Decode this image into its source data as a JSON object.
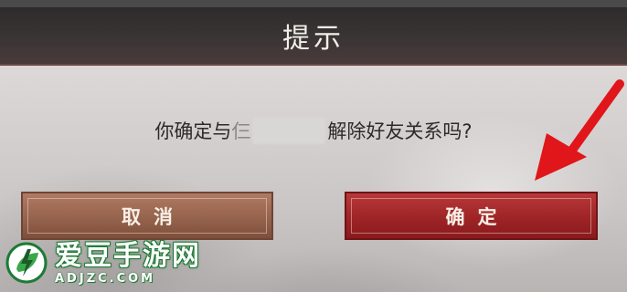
{
  "dialog": {
    "title": "提示",
    "message_before": "你确定与",
    "message_partial": "仨",
    "message_after": "解除好友关系吗?",
    "cancel_label": "取消",
    "confirm_label": "确定"
  },
  "annotation": {
    "arrow_color": "#e0161a",
    "arrow_target": "confirm-button"
  },
  "watermark": {
    "logo_icon": "lightning-leaf-icon",
    "name": "爱豆手游网",
    "url": "ADJZC.COM"
  },
  "colors": {
    "title_bar": "#2f2c2c",
    "cancel_button": "#96634d",
    "confirm_button": "#9e2426",
    "watermark_green": "#1e7a35"
  }
}
